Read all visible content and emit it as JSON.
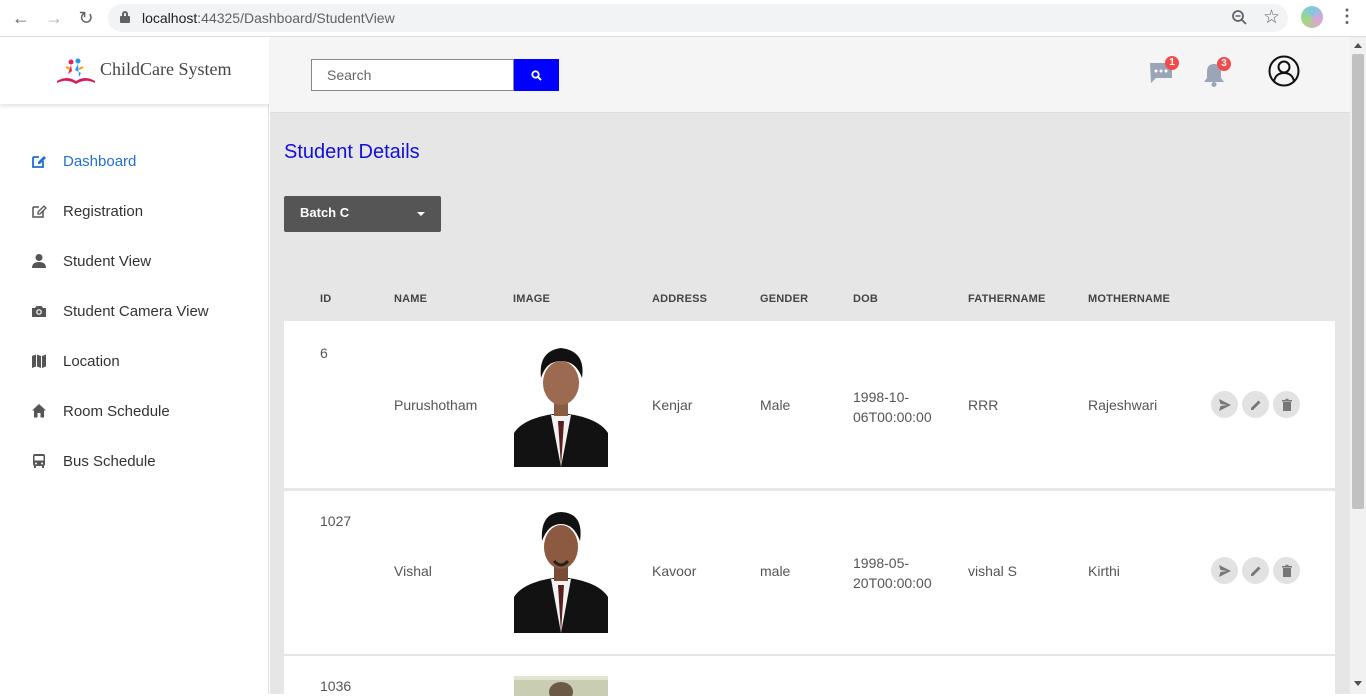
{
  "browser": {
    "url_host": "localhost",
    "url_rest": ":44325/Dashboard/StudentView"
  },
  "brand": {
    "name": "ChildCare System"
  },
  "sidebar": {
    "items": [
      {
        "label": "Dashboard",
        "icon": "edit-icon",
        "active": true
      },
      {
        "label": "Registration",
        "icon": "edit-icon"
      },
      {
        "label": "Student View",
        "icon": "user-icon"
      },
      {
        "label": "Student Camera View",
        "icon": "camera-icon"
      },
      {
        "label": "Location",
        "icon": "map-icon"
      },
      {
        "label": "Room Schedule",
        "icon": "home-icon"
      },
      {
        "label": "Bus Schedule",
        "icon": "bus-icon"
      }
    ]
  },
  "topbar": {
    "search_placeholder": "Search",
    "messages_badge": "1",
    "notifications_badge": "3"
  },
  "main": {
    "title": "Student Details",
    "batch": "Batch C",
    "columns": [
      "ID",
      "NAME",
      "IMAGE",
      "ADDRESS",
      "GENDER",
      "DOB",
      "FATHERNAME",
      "MOTHERNAME"
    ],
    "rows": [
      {
        "id": "6",
        "name": "Purushotham",
        "address": "Kenjar",
        "gender": "Male",
        "dob_1": "1998-10-",
        "dob_2": "06T00:00:00",
        "father": "RRR",
        "mother": "Rajeshwari"
      },
      {
        "id": "1027",
        "name": "Vishal",
        "address": "Kavoor",
        "gender": "male",
        "dob_1": "1998-05-",
        "dob_2": "20T00:00:00",
        "father": "vishal S",
        "mother": "Kirthi"
      },
      {
        "id": "1036",
        "name": "",
        "address": "",
        "gender": "",
        "dob_1": "",
        "dob_2": "",
        "father": "",
        "mother": ""
      }
    ]
  },
  "colors": {
    "accent_blue": "#0000ff",
    "title_blue": "#1010d8",
    "active_menu": "#1f6fd6",
    "badge_red": "#f24b4b"
  }
}
